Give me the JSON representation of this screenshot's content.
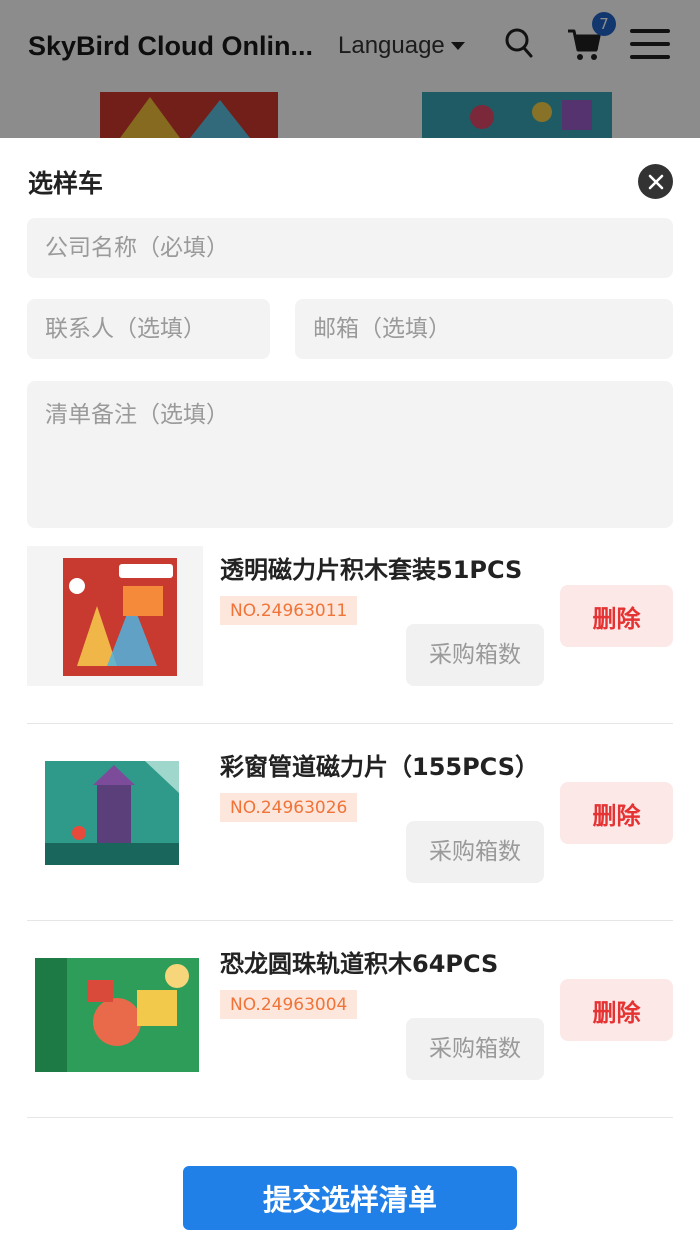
{
  "header": {
    "brand": "SkyBird Cloud Onlin...",
    "language_label": "Language",
    "cart_count": "7"
  },
  "sheet": {
    "title": "选样车",
    "company_placeholder": "公司名称（必填）",
    "contact_placeholder": "联系人（选填）",
    "email_placeholder": "邮箱（选填）",
    "note_placeholder": "清单备注（选填）",
    "qty_placeholder": "采购箱数",
    "delete_label": "删除",
    "submit_label": "提交选样清单"
  },
  "items": [
    {
      "name": "透明磁力片积木套装51PCS",
      "no": "NO.24963011"
    },
    {
      "name": "彩窗管道磁力片（155PCS）",
      "no": "NO.24963026"
    },
    {
      "name": "恐龙圆珠轨道积木64PCS",
      "no": "NO.24963004"
    }
  ],
  "colors": {
    "accent": "#2080e8",
    "delete_text": "#e53333",
    "delete_bg": "#fde8e8",
    "tag_text": "#f07438",
    "tag_bg": "#fde6dc",
    "badge": "#1f64c9"
  }
}
